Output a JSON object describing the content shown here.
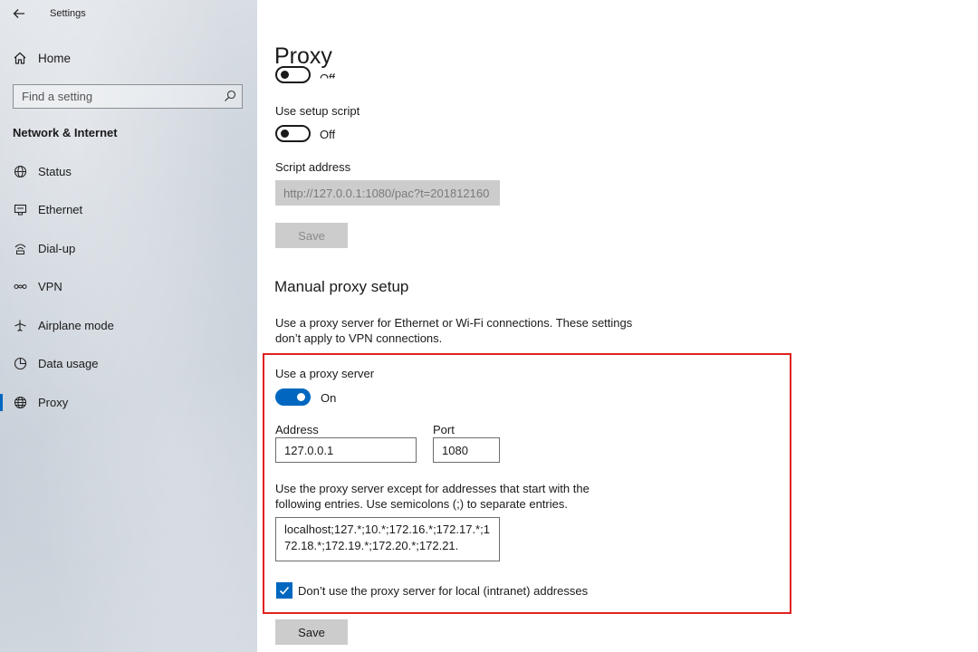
{
  "window": {
    "title": "Settings"
  },
  "sidebar": {
    "home_label": "Home",
    "search_placeholder": "Find a setting",
    "section_title": "Network & Internet",
    "items": [
      {
        "label": "Status",
        "icon": "globe-status-icon"
      },
      {
        "label": "Ethernet",
        "icon": "ethernet-icon"
      },
      {
        "label": "Dial-up",
        "icon": "dial-up-icon"
      },
      {
        "label": "VPN",
        "icon": "vpn-icon"
      },
      {
        "label": "Airplane mode",
        "icon": "airplane-icon"
      },
      {
        "label": "Data usage",
        "icon": "data-usage-icon"
      },
      {
        "label": "Proxy",
        "icon": "globe-icon",
        "active": true
      }
    ]
  },
  "main": {
    "title": "Proxy",
    "auto_toggle_state": "Off",
    "setup_script": {
      "label": "Use setup script",
      "state": "Off",
      "address_label": "Script address",
      "address_value": "http://127.0.0.1:1080/pac?t=201812160",
      "save_label": "Save"
    },
    "manual": {
      "title": "Manual proxy setup",
      "description": "Use a proxy server for Ethernet or Wi-Fi connections. These settings don’t apply to VPN connections.",
      "use_proxy_label": "Use a proxy server",
      "use_proxy_state": "On",
      "address_label": "Address",
      "address_value": "127.0.0.1",
      "port_label": "Port",
      "port_value": "1080",
      "exceptions_label": "Use the proxy server except for addresses that start with the following entries. Use semicolons (;) to separate entries.",
      "exceptions_value": "localhost;127.*;10.*;172.16.*;172.17.*;172.18.*;172.19.*;172.20.*;172.21.",
      "local_checkbox_label": "Don’t use the proxy server for local (intranet) addresses",
      "local_checked": true,
      "save_label": "Save"
    }
  },
  "colors": {
    "accent": "#0067c0",
    "highlight_border": "#e0211f",
    "disabled_bg": "#cccccc"
  }
}
